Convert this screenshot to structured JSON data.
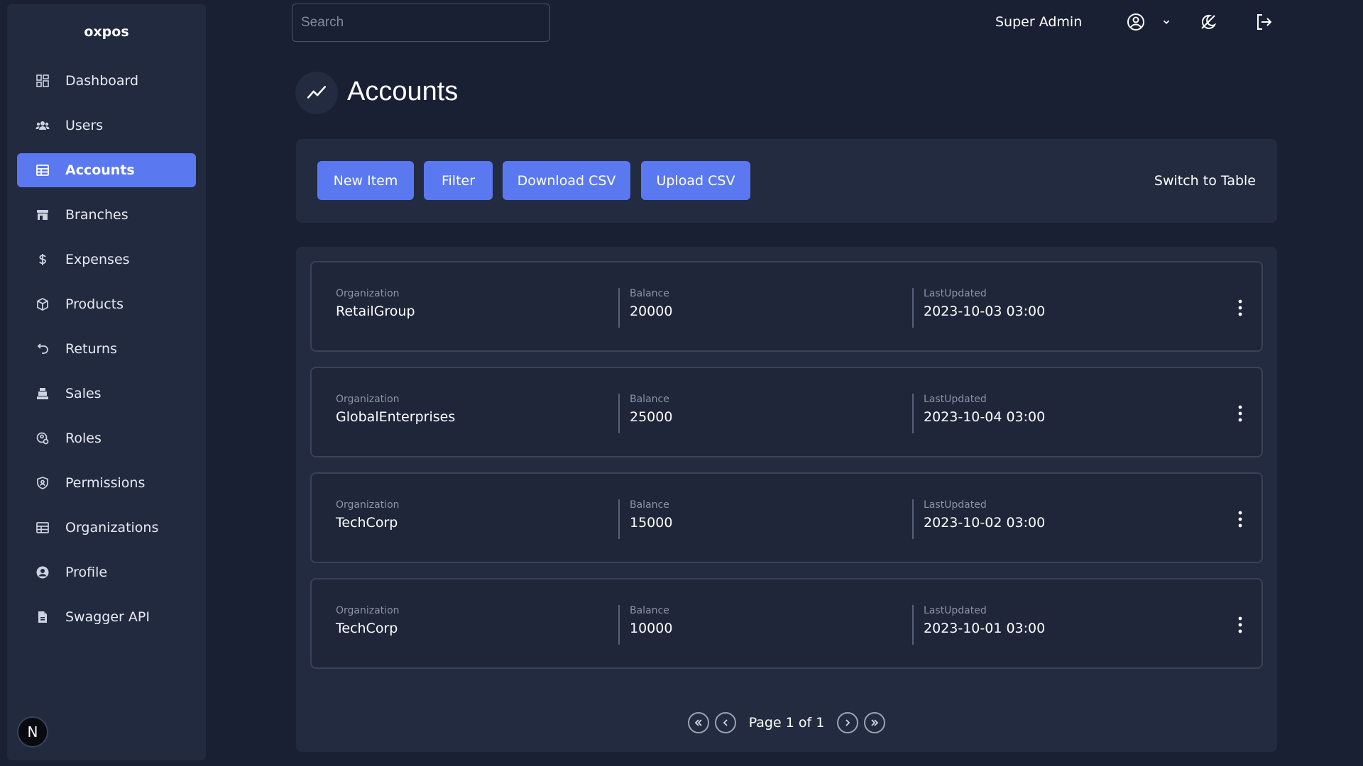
{
  "app": {
    "brand": "oxpos"
  },
  "sidebar": {
    "items": [
      {
        "label": "Dashboard",
        "icon": "grid-icon"
      },
      {
        "label": "Users",
        "icon": "users-icon"
      },
      {
        "label": "Accounts",
        "icon": "table-icon",
        "active": true
      },
      {
        "label": "Branches",
        "icon": "store-icon"
      },
      {
        "label": "Expenses",
        "icon": "dollar-icon"
      },
      {
        "label": "Products",
        "icon": "box-icon"
      },
      {
        "label": "Returns",
        "icon": "undo-icon"
      },
      {
        "label": "Sales",
        "icon": "register-icon"
      },
      {
        "label": "Roles",
        "icon": "role-icon"
      },
      {
        "label": "Permissions",
        "icon": "shield-icon"
      },
      {
        "label": "Organizations",
        "icon": "table-icon"
      },
      {
        "label": "Profile",
        "icon": "user-circle-icon"
      },
      {
        "label": "Swagger API",
        "icon": "file-icon"
      }
    ],
    "badge": "N"
  },
  "topbar": {
    "search_placeholder": "Search",
    "user_name": "Super Admin"
  },
  "page": {
    "title": "Accounts"
  },
  "toolbar": {
    "new_item": "New Item",
    "filter": "Filter",
    "download_csv": "Download CSV",
    "upload_csv": "Upload CSV",
    "switch_view": "Switch to Table"
  },
  "columns": {
    "organization": "Organization",
    "balance": "Balance",
    "last_updated": "LastUpdated"
  },
  "rows": [
    {
      "organization": "RetailGroup",
      "balance": "20000",
      "last_updated": "2023-10-03 03:00"
    },
    {
      "organization": "GlobalEnterprises",
      "balance": "25000",
      "last_updated": "2023-10-04 03:00"
    },
    {
      "organization": "TechCorp",
      "balance": "15000",
      "last_updated": "2023-10-02 03:00"
    },
    {
      "organization": "TechCorp",
      "balance": "10000",
      "last_updated": "2023-10-01 03:00"
    }
  ],
  "pagination": {
    "text": "Page 1 of 1"
  },
  "colors": {
    "accent": "#5a78f0",
    "background": "#1a2033",
    "panel": "#232b41"
  }
}
